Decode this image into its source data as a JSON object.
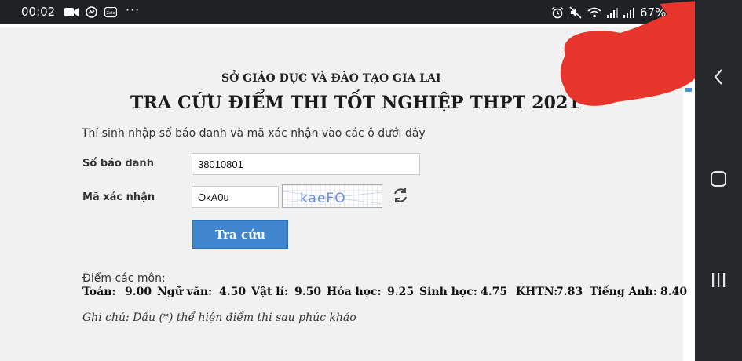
{
  "status_bar": {
    "time": "00:02",
    "battery_percent": "67%",
    "left_icons": [
      "video-icon",
      "messenger-icon",
      "zalo-icon"
    ],
    "more": "···",
    "right_icons": [
      "alarm-icon",
      "mute-icon",
      "wifi-icon",
      "signal-icon",
      "signal-icon",
      "battery-icon"
    ]
  },
  "form": {
    "department": "SỞ GIÁO DỤC VÀ ĐÀO TẠO GIA LAI",
    "title": "TRA CỨU ĐIỂM THI TỐT NGHIỆP THPT 2021",
    "instruction": "Thí sinh nhập số báo danh và mã xác nhận vào các ô dưới đây",
    "sbd_label": "Số báo danh",
    "sbd_value": "38010801",
    "captcha_label": "Mã xác nhận",
    "captcha_value": "OkA0u",
    "captcha_image_text": "kaeFO",
    "submit_label": "Tra cứu"
  },
  "results": {
    "caption": "Điểm các môn:",
    "subjects": [
      {
        "name": "Toán:",
        "score": "9.00"
      },
      {
        "name": "Ngữ văn:",
        "score": "4.50"
      },
      {
        "name": "Vật lí:",
        "score": "9.50"
      },
      {
        "name": "Hóa học:",
        "score": "9.25"
      },
      {
        "name": "Sinh học:",
        "score": "4.75"
      },
      {
        "name": "KHTN:",
        "score": "7.83"
      },
      {
        "name": "Tiếng Anh:",
        "score": "8.40"
      }
    ],
    "note": "Ghi chú: Dấu (*) thể hiện điểm thi sau phúc khảo"
  },
  "colors": {
    "button": "#3f86cf",
    "page_bg": "#f1f1f1",
    "status_bar": "#202124",
    "nav_bar": "#27282b",
    "scribble": "#e8352b"
  }
}
